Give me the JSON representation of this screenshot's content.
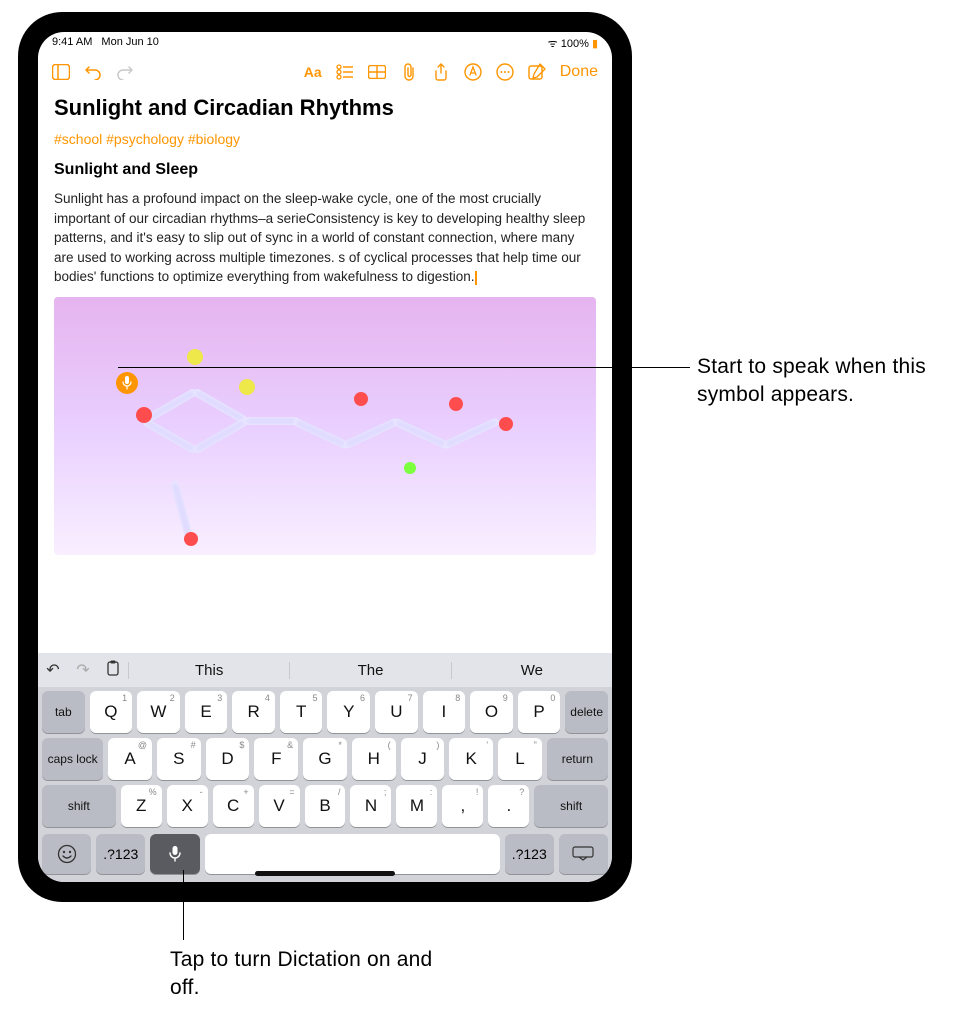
{
  "status": {
    "time": "9:41 AM",
    "date": "Mon Jun 10",
    "battery": "100%"
  },
  "toolbar": {
    "sidebar_icon": "sidebar-icon",
    "undo_icon": "undo-icon",
    "redo_icon": "redo-icon",
    "format_icon": "format-icon",
    "list_icon": "list-icon",
    "table_icon": "table-icon",
    "attach_icon": "attach-icon",
    "share_icon": "share-icon",
    "markup_icon": "markup-icon",
    "more_icon": "more-icon",
    "compose_icon": "compose-icon",
    "done_label": "Done"
  },
  "note": {
    "title": "Sunlight and Circadian Rhythms",
    "tags": "#school #psychology #biology",
    "subheading": "Sunlight and Sleep",
    "body": "Sunlight has a profound impact on the sleep-wake cycle, one of the most crucially important of our circadian rhythms–a serieConsistency is key to developing healthy sleep patterns, and it's easy to slip out of sync in a world of constant connection, where many are used to working across multiple timezones. s of cyclical processes that help time our bodies' functions to optimize everything from wakefulness to digestion."
  },
  "dictation_indicator_icon": "microphone-icon",
  "keyboard": {
    "suggestions": {
      "undo": "↩",
      "redo": "↪",
      "clipboard": "📋",
      "w1": "This",
      "w2": "The",
      "w3": "We"
    },
    "row1_alts": [
      "1",
      "2",
      "3",
      "4",
      "5",
      "6",
      "7",
      "8",
      "9",
      "0"
    ],
    "row1": [
      "Q",
      "W",
      "E",
      "R",
      "T",
      "Y",
      "U",
      "I",
      "O",
      "P"
    ],
    "row2_alts": [
      "@",
      "#",
      "$",
      "&",
      "*",
      "(",
      ")",
      "'",
      "\""
    ],
    "row2": [
      "A",
      "S",
      "D",
      "F",
      "G",
      "H",
      "J",
      "K",
      "L"
    ],
    "row3_alts": [
      "%",
      "-",
      "+",
      "=",
      "/",
      ";",
      ":",
      "!",
      "?"
    ],
    "row3": [
      "Z",
      "X",
      "C",
      "V",
      "B",
      "N",
      "M",
      ",",
      "."
    ],
    "tab": "tab",
    "delete": "delete",
    "caps": "caps lock",
    "return": "return",
    "shift": "shift",
    "emoji": "😀",
    "numkey": ".?123",
    "mic": "🎤",
    "hide": "⌨"
  },
  "callouts": {
    "right": "Start to speak when this symbol appears.",
    "bottom": "Tap to turn Dictation on and off."
  }
}
